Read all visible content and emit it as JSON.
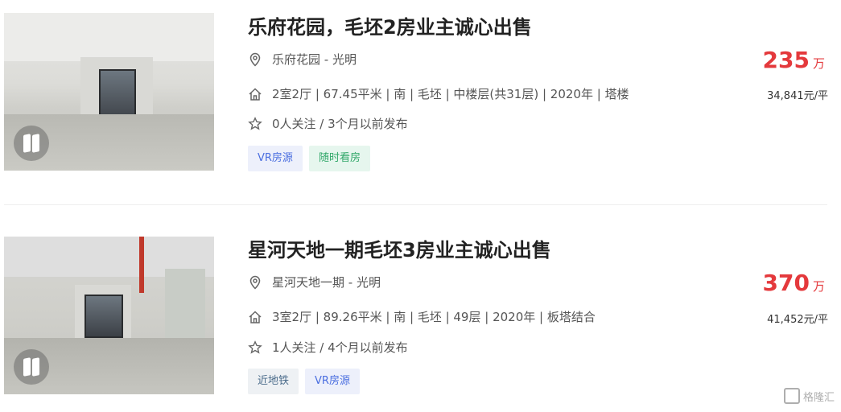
{
  "listings": [
    {
      "title": "乐府花园，毛坯2房业主诚心出售",
      "location": "乐府花园 - 光明",
      "info": "2室2厅 | 67.45平米 | 南 | 毛坯 | 中楼层(共31层) | 2020年 | 塔楼",
      "follow": "0人关注 / 3个月以前发布",
      "tags": [
        "VR房源",
        "随时看房"
      ],
      "price": "235",
      "price_unit": "万",
      "unit_price": "34,841元/平"
    },
    {
      "title": "星河天地一期毛坯3房业主诚心出售",
      "location": "星河天地一期 - 光明",
      "info": "3室2厅 | 89.26平米 | 南 | 毛坯 | 49层 | 2020年 | 板塔结合",
      "follow": "1人关注 / 4个月以前发布",
      "tags": [
        "近地铁",
        "VR房源"
      ],
      "price": "370",
      "price_unit": "万",
      "unit_price": "41,452元/平"
    }
  ],
  "watermark": "格隆汇",
  "colors": {
    "price": "#e4393c",
    "tag_blue": "#4a6ee0",
    "tag_green": "#32a86a"
  },
  "icons": [
    "location-pin-icon",
    "house-icon",
    "star-icon",
    "vr-icon"
  ]
}
